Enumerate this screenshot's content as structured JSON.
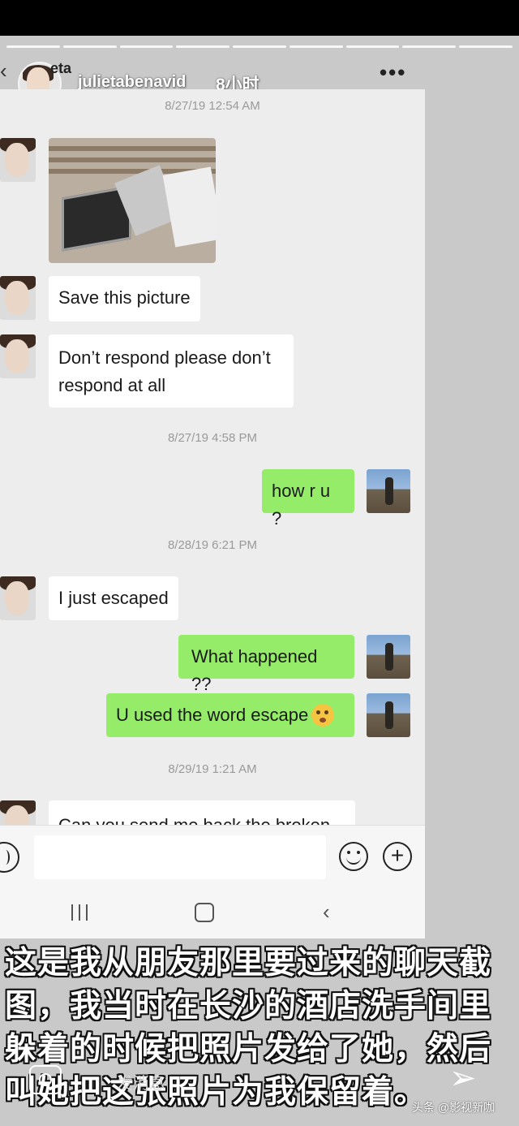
{
  "story": {
    "username": "julietabenavid",
    "time": "8小时",
    "name_overlay": "eta",
    "more": "•••"
  },
  "chat": {
    "timestamps": [
      "8/27/19 12:54 AM",
      "8/27/19 4:58 PM",
      "8/28/19 6:21 PM",
      "8/29/19 1:21 AM"
    ],
    "messages": [
      {
        "side": "in",
        "text": "Save this picture"
      },
      {
        "side": "in",
        "text": "Don’t respond please don’t respond at all"
      },
      {
        "side": "out",
        "text": "how r u ?"
      },
      {
        "side": "in",
        "text": "I just escaped"
      },
      {
        "side": "out",
        "text": "What happened ??"
      },
      {
        "side": "out",
        "text": "U used the word escape"
      },
      {
        "side": "in",
        "text": "Can you send me back the broken"
      }
    ]
  },
  "caption": "这是我从朋友那里要过来的聊天截图，我当时在长沙的酒店洗手间里躲着的时候把照片发给了她，然后叫她把这张照片为我保留着。",
  "reply": {
    "placeholder": "发消息"
  },
  "watermark": "头条 @影视新咖"
}
